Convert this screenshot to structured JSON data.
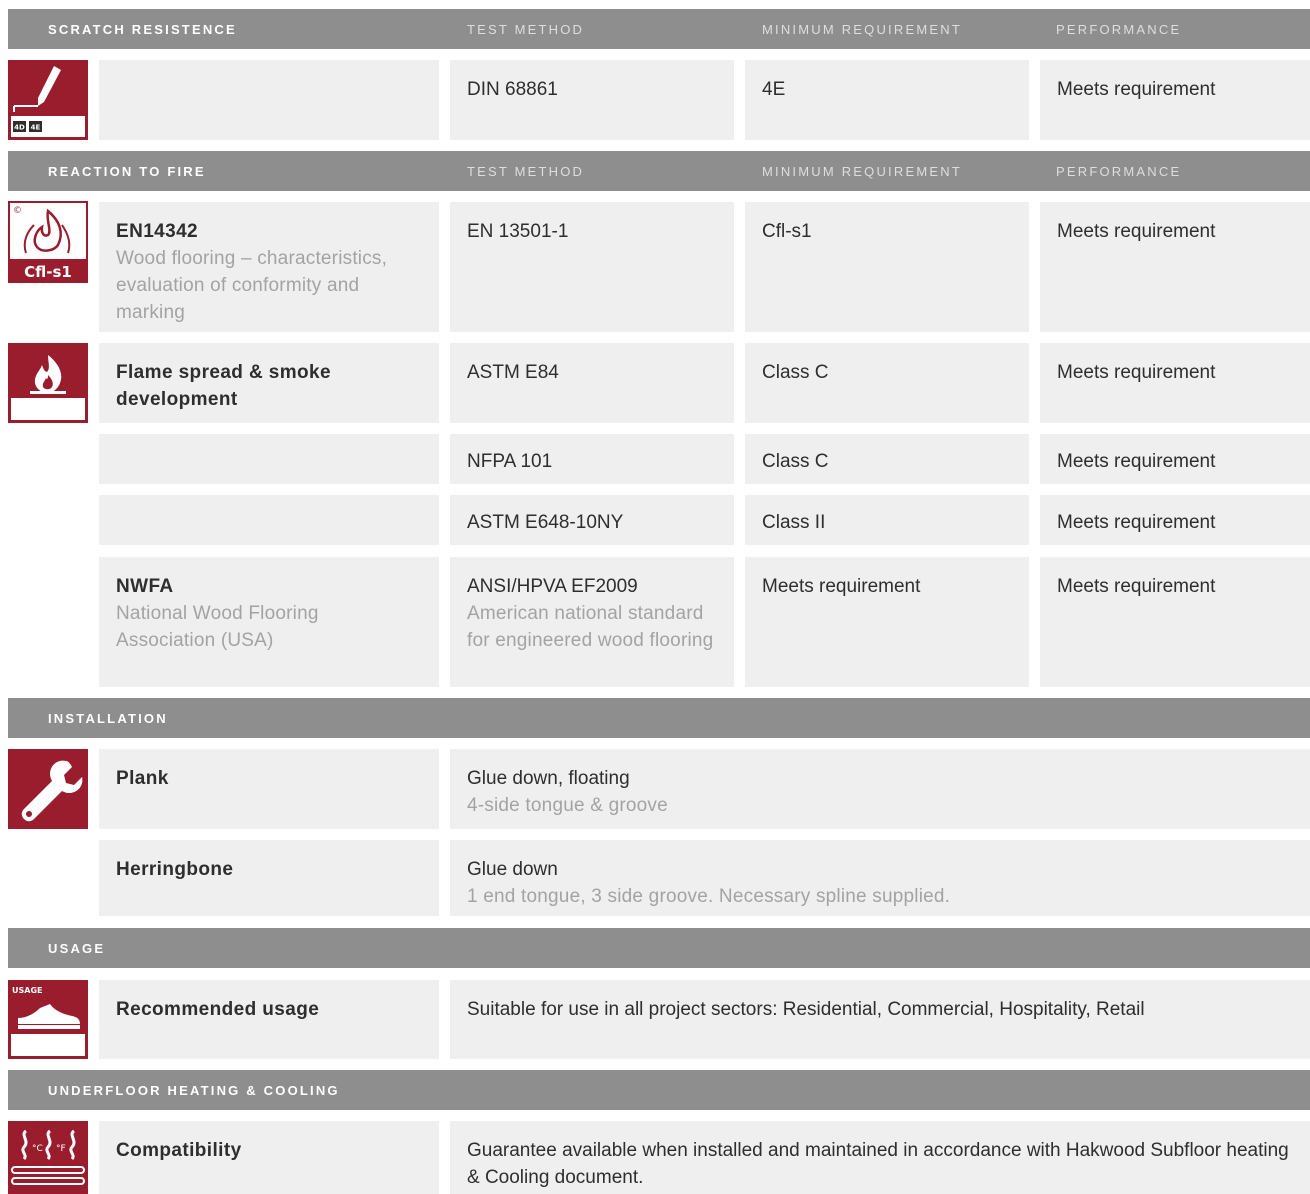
{
  "columns": {
    "test_method": "TEST METHOD",
    "minimum_requirement": "MINIMUM REQUIREMENT",
    "performance": "PERFORMANCE"
  },
  "colors": {
    "accent": "#9a1d2e",
    "bar": "#8e8e8e",
    "cell": "#efefef",
    "subtext": "#a3a3a3"
  },
  "scratch": {
    "title": "SCRATCH RESISTENCE",
    "icon": {
      "name": "scratch-pen-icon",
      "labels": [
        "4D",
        "4E"
      ]
    },
    "row": {
      "test_method": "DIN 68861",
      "minimum": "4E",
      "performance": "Meets requirement"
    }
  },
  "fire": {
    "title": "REACTION TO FIRE",
    "icon1": {
      "name": "fire-classification-icon",
      "mark": "©",
      "label": "Cfl-s1"
    },
    "icon2": {
      "name": "flame-icon"
    },
    "rows": [
      {
        "label": "EN14342",
        "sub": "Wood flooring – characteristics, evaluation of conformity and marking",
        "test_method": "EN 13501-1",
        "test_sub": "",
        "minimum": "Cfl-s1",
        "performance": "Meets requirement"
      },
      {
        "label": "Flame spread & smoke development",
        "sub": "",
        "test_method": "ASTM E84",
        "test_sub": "",
        "minimum": "Class C",
        "performance": "Meets requirement"
      },
      {
        "label": "",
        "sub": "",
        "test_method": "NFPA 101",
        "test_sub": "",
        "minimum": "Class C",
        "performance": "Meets requirement"
      },
      {
        "label": "",
        "sub": "",
        "test_method": "ASTM E648-10NY",
        "test_sub": "",
        "minimum": "Class II",
        "performance": "Meets requirement"
      },
      {
        "label": "NWFA",
        "sub": "National Wood Flooring Association (USA)",
        "test_method": "ANSI/HPVA EF2009",
        "test_sub": "American national standard for engineered wood flooring",
        "minimum": "Meets requirement",
        "performance": "Meets requirement"
      }
    ]
  },
  "installation": {
    "title": "INSTALLATION",
    "icon": {
      "name": "wrench-icon"
    },
    "rows": [
      {
        "label": "Plank",
        "value": "Glue down, floating",
        "sub": "4-side tongue & groove"
      },
      {
        "label": "Herringbone",
        "value": "Glue down",
        "sub": "1 end tongue, 3 side groove. Necessary spline supplied."
      }
    ]
  },
  "usage": {
    "title": "USAGE",
    "icon": {
      "name": "shoe-usage-icon",
      "label": "USAGE"
    },
    "row": {
      "label": "Recommended usage",
      "value": "Suitable for use in all project sectors: Residential, Commercial, Hospitality, Retail"
    }
  },
  "heating": {
    "title": "UNDERFLOOR HEATING & COOLING",
    "icon": {
      "name": "underfloor-heating-icon",
      "c": "°C",
      "f": "°F"
    },
    "row": {
      "label": "Compatibility",
      "value": "Guarantee available when installed and maintained in accordance with Hakwood Subfloor heating & Cooling document."
    }
  }
}
